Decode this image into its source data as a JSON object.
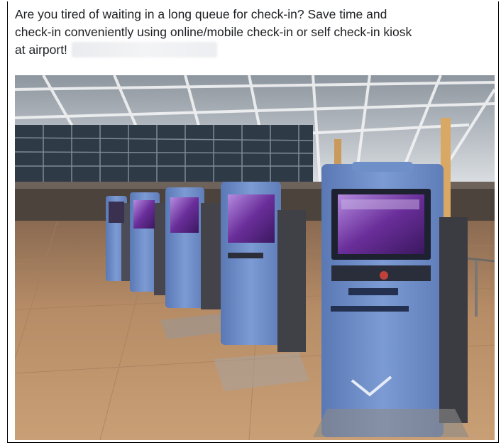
{
  "post": {
    "text_line_1": "Are you tired of waiting in a long queue for check-in? Save time and",
    "text_line_2": "check-in conveniently using online/mobile check-in or self check-in kiosk",
    "text_line_3": "at airport!"
  },
  "photo": {
    "subject": "self-check-in-kiosks-airport-terminal",
    "colors": {
      "kiosk_body": "#6f8fc9",
      "kiosk_dark": "#3f4d70",
      "screen": "#7a3fa6",
      "floor": "#b58a62",
      "ceiling": "#cfd5dc"
    }
  }
}
